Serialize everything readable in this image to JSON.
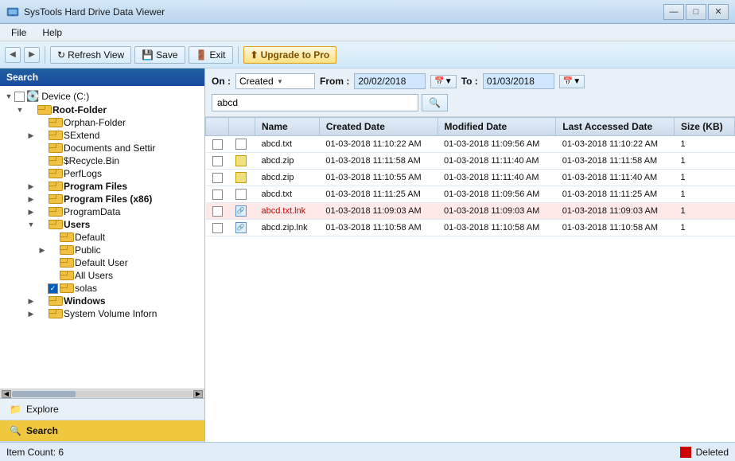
{
  "app": {
    "title": "SysTools Hard Drive Data Viewer",
    "min_label": "—",
    "max_label": "□",
    "close_label": "✕"
  },
  "menu": {
    "items": [
      "File",
      "Help"
    ]
  },
  "toolbar": {
    "prev_label": "◀",
    "next_label": "▶",
    "refresh_label": "Refresh View",
    "save_label": "Save",
    "exit_label": "Exit",
    "upgrade_label": "Upgrade to Pro"
  },
  "left_panel": {
    "search_header": "Search",
    "tree": [
      {
        "id": "device-c",
        "label": "Device (C:)",
        "indent": "indent1",
        "type": "drive",
        "expand": "▼",
        "has_cb": true,
        "checked": false
      },
      {
        "id": "root-folder",
        "label": "Root-Folder",
        "indent": "indent2",
        "type": "folder",
        "expand": "▼",
        "has_cb": false,
        "bold": true
      },
      {
        "id": "orphan-folder",
        "label": "Orphan-Folder",
        "indent": "indent3",
        "type": "folder",
        "expand": "",
        "has_cb": false,
        "bold": false
      },
      {
        "id": "sextend",
        "label": "SExtend",
        "indent": "indent3",
        "type": "folder",
        "expand": "▶",
        "has_cb": false,
        "bold": false
      },
      {
        "id": "documents",
        "label": "Documents and Settir",
        "indent": "indent3",
        "type": "folder",
        "expand": "",
        "has_cb": false,
        "bold": false
      },
      {
        "id": "srecycle",
        "label": "$Recycle.Bin",
        "indent": "indent3",
        "type": "folder",
        "expand": "",
        "has_cb": false,
        "bold": false
      },
      {
        "id": "perflogs",
        "label": "PerfLogs",
        "indent": "indent3",
        "type": "folder",
        "expand": "",
        "has_cb": false,
        "bold": false
      },
      {
        "id": "program-files",
        "label": "Program Files",
        "indent": "indent3",
        "type": "folder",
        "expand": "▶",
        "has_cb": false,
        "bold": true
      },
      {
        "id": "program-files-x86",
        "label": "Program Files (x86)",
        "indent": "indent3",
        "type": "folder",
        "expand": "▶",
        "has_cb": false,
        "bold": true
      },
      {
        "id": "programdata",
        "label": "ProgramData",
        "indent": "indent3",
        "type": "folder",
        "expand": "▶",
        "has_cb": false,
        "bold": false
      },
      {
        "id": "users",
        "label": "Users",
        "indent": "indent3",
        "type": "folder",
        "expand": "▼",
        "has_cb": false,
        "bold": true
      },
      {
        "id": "default",
        "label": "Default",
        "indent": "indent4",
        "type": "folder",
        "expand": "",
        "has_cb": false,
        "bold": false
      },
      {
        "id": "public",
        "label": "Public",
        "indent": "indent4",
        "type": "folder",
        "expand": "▶",
        "has_cb": false,
        "bold": false
      },
      {
        "id": "default-user",
        "label": "Default User",
        "indent": "indent4",
        "type": "folder",
        "expand": "",
        "has_cb": false,
        "bold": false
      },
      {
        "id": "all-users",
        "label": "All Users",
        "indent": "indent4",
        "type": "folder",
        "expand": "",
        "has_cb": false,
        "bold": false
      },
      {
        "id": "solas",
        "label": "solas",
        "indent": "indent4",
        "type": "folder",
        "expand": "",
        "has_cb": true,
        "checked": true
      },
      {
        "id": "windows",
        "label": "Windows",
        "indent": "indent3",
        "type": "folder",
        "expand": "▶",
        "has_cb": false,
        "bold": true
      },
      {
        "id": "system-volume",
        "label": "System Volume Inforn",
        "indent": "indent3",
        "type": "folder",
        "expand": "▶",
        "has_cb": false,
        "bold": false
      }
    ],
    "nav": [
      {
        "id": "explore",
        "label": "Explore",
        "icon": "📁",
        "active": false
      },
      {
        "id": "search",
        "label": "Search",
        "icon": "🔍",
        "active": true
      }
    ]
  },
  "right_panel": {
    "search": {
      "on_label": "On :",
      "dropdown_value": "Created",
      "from_label": "From :",
      "from_value": "20/02/2018",
      "to_label": "To :",
      "to_value": "01/03/2018",
      "search_text": "abcd",
      "search_placeholder": ""
    },
    "table": {
      "columns": [
        "",
        "Name",
        "Created Date",
        "Modified Date",
        "Last Accessed Date",
        "Size (KB)"
      ],
      "rows": [
        {
          "name": "abcd.txt",
          "type": "txt",
          "created": "01-03-2018 11:10:22 AM",
          "modified": "01-03-2018 11:09:56 AM",
          "accessed": "01-03-2018 11:10:22 AM",
          "size": "1",
          "deleted": false
        },
        {
          "name": "abcd.zip",
          "type": "zip",
          "created": "01-03-2018 11:11:58 AM",
          "modified": "01-03-2018 11:11:40 AM",
          "accessed": "01-03-2018 11:11:58 AM",
          "size": "1",
          "deleted": false
        },
        {
          "name": "abcd.zip",
          "type": "zip",
          "created": "01-03-2018 11:10:55 AM",
          "modified": "01-03-2018 11:11:40 AM",
          "accessed": "01-03-2018 11:11:40 AM",
          "size": "1",
          "deleted": false
        },
        {
          "name": "abcd.txt",
          "type": "txt",
          "created": "01-03-2018 11:11:25 AM",
          "modified": "01-03-2018 11:09:56 AM",
          "accessed": "01-03-2018 11:11:25 AM",
          "size": "1",
          "deleted": false
        },
        {
          "name": "abcd.txt.lnk",
          "type": "lnk",
          "created": "01-03-2018 11:09:03 AM",
          "modified": "01-03-2018 11:09:03 AM",
          "accessed": "01-03-2018 11:09:03 AM",
          "size": "1",
          "deleted": true
        },
        {
          "name": "abcd.zip.lnk",
          "type": "lnk",
          "created": "01-03-2018 11:10:58 AM",
          "modified": "01-03-2018 11:10:58 AM",
          "accessed": "01-03-2018 11:10:58 AM",
          "size": "1",
          "deleted": false
        }
      ]
    }
  },
  "status": {
    "item_count_label": "Item Count: 6",
    "deleted_label": "Deleted"
  }
}
